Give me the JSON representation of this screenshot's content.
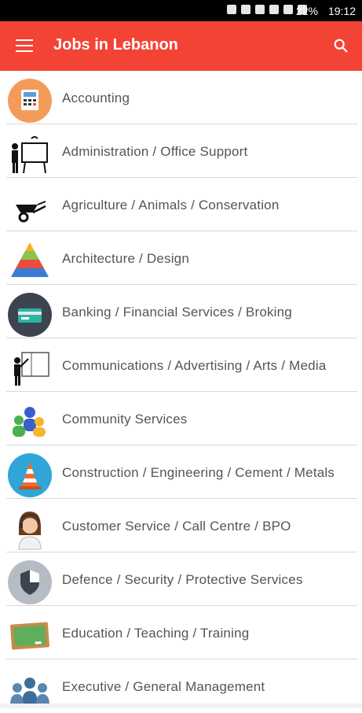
{
  "status_bar": {
    "battery": "22%",
    "time": "19:12",
    "icons": [
      "notification-icon",
      "mute-icon",
      "image-icon",
      "calendar-icon",
      "data-icon",
      "signal-icon",
      "wifi-icon"
    ]
  },
  "app_bar": {
    "title": "Jobs in Lebanon",
    "accent_color": "#f24335",
    "icons": [
      "menu-icon",
      "search-icon"
    ]
  },
  "categories": [
    {
      "label": "Accounting",
      "icon": "calculator-icon"
    },
    {
      "label": "Administration / Office Support",
      "icon": "presentation-icon"
    },
    {
      "label": "Agriculture / Animals / Conservation",
      "icon": "wheelbarrow-icon"
    },
    {
      "label": "Architecture / Design",
      "icon": "pyramid-icon"
    },
    {
      "label": "Banking / Financial Services / Broking",
      "icon": "card-icon"
    },
    {
      "label": "Communications / Advertising / Arts / Media",
      "icon": "presenter-icon"
    },
    {
      "label": "Community Services",
      "icon": "people-group-icon"
    },
    {
      "label": "Construction / Engineering / Cement / Metals",
      "icon": "traffic-cone-icon"
    },
    {
      "label": "Customer Service / Call Centre / BPO",
      "icon": "headset-agent-icon"
    },
    {
      "label": "Defence / Security / Protective Services",
      "icon": "shield-icon"
    },
    {
      "label": "Education / Teaching / Training",
      "icon": "chalkboard-icon"
    },
    {
      "label": "Executive / General Management",
      "icon": "executives-icon"
    }
  ]
}
